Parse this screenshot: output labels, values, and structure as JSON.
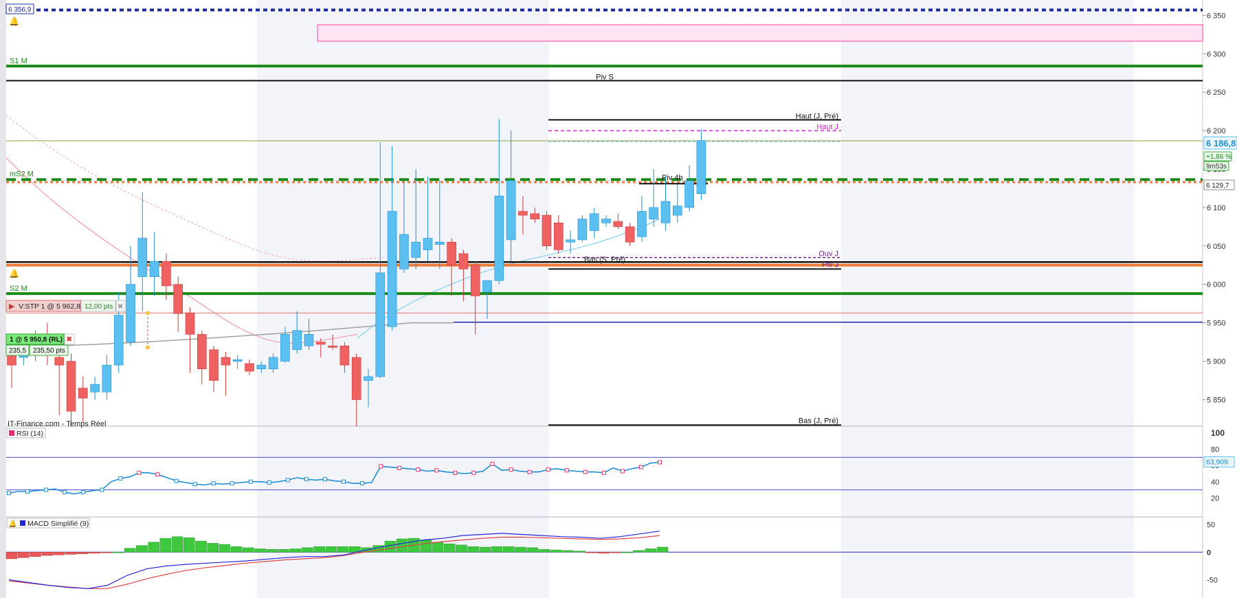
{
  "colors": {
    "up": "#5bc0f0",
    "up_stroke": "#1f8fd0",
    "down": "#f06262",
    "down_stroke": "#c83a3a",
    "green": "#188a18",
    "orange": "#f07c3a",
    "navy": "#1c2a9c",
    "magenta": "#d41ed4",
    "rsi": "#e83070",
    "macd": "#2626d6",
    "signal": "#e04040",
    "hist": "#3ec83e"
  },
  "source_label": "IT-Finance.com - Temps Réel",
  "price_box": {
    "value": "6 186,8",
    "change": "+1,86 %",
    "timer": "9m53s"
  },
  "marker_129": "6 129,7",
  "alert_top": "6 356,9",
  "order_stop": {
    "label": "V:STP  1 @ 5 962,8",
    "pts": "12,00 pts",
    "x": "✖"
  },
  "order_pos": {
    "label": "1 @ 5 950,8 (RL)",
    "val": "235,5",
    "pts": "235,50 pts",
    "x": "✖"
  },
  "chart_data": [
    {
      "type": "candlestick",
      "ylim": [
        5820,
        6370
      ],
      "y_ticks": [
        5850,
        5900,
        5950,
        6000,
        6050,
        6100,
        6150,
        6200,
        6250,
        6300,
        6350
      ],
      "y_tick_labels": [
        "5 850",
        "5 900",
        "5 950",
        "6 000",
        "6 050",
        "6 100",
        "6 150",
        "6 200",
        "6 250",
        "6 300",
        "6 350"
      ],
      "candles": [
        {
          "o": 5910,
          "h": 5930,
          "l": 5865,
          "c": 5895
        },
        {
          "o": 5905,
          "h": 5935,
          "l": 5895,
          "c": 5915
        },
        {
          "o": 5915,
          "h": 5940,
          "l": 5900,
          "c": 5920
        },
        {
          "o": 5918,
          "h": 5950,
          "l": 5895,
          "c": 5910
        },
        {
          "o": 5905,
          "h": 5935,
          "l": 5830,
          "c": 5895
        },
        {
          "o": 5900,
          "h": 5910,
          "l": 5815,
          "c": 5835
        },
        {
          "o": 5865,
          "h": 5880,
          "l": 5820,
          "c": 5852
        },
        {
          "o": 5860,
          "h": 5880,
          "l": 5850,
          "c": 5870
        },
        {
          "o": 5860,
          "h": 5908,
          "l": 5850,
          "c": 5895
        },
        {
          "o": 5895,
          "h": 5990,
          "l": 5885,
          "c": 5960
        },
        {
          "o": 5925,
          "h": 6050,
          "l": 5920,
          "c": 6000
        },
        {
          "o": 6010,
          "h": 6120,
          "l": 5965,
          "c": 6060
        },
        {
          "o": 6010,
          "h": 6068,
          "l": 5985,
          "c": 6030
        },
        {
          "o": 6030,
          "h": 6040,
          "l": 5980,
          "c": 5998
        },
        {
          "o": 6000,
          "h": 6010,
          "l": 5938,
          "c": 5962
        },
        {
          "o": 5963,
          "h": 5970,
          "l": 5885,
          "c": 5935
        },
        {
          "o": 5935,
          "h": 5940,
          "l": 5870,
          "c": 5890
        },
        {
          "o": 5915,
          "h": 5920,
          "l": 5860,
          "c": 5875
        },
        {
          "o": 5905,
          "h": 5912,
          "l": 5855,
          "c": 5895
        },
        {
          "o": 5900,
          "h": 5908,
          "l": 5890,
          "c": 5902
        },
        {
          "o": 5897,
          "h": 5902,
          "l": 5882,
          "c": 5887
        },
        {
          "o": 5890,
          "h": 5900,
          "l": 5885,
          "c": 5895
        },
        {
          "o": 5890,
          "h": 5910,
          "l": 5885,
          "c": 5905
        },
        {
          "o": 5900,
          "h": 5945,
          "l": 5898,
          "c": 5935
        },
        {
          "o": 5915,
          "h": 5965,
          "l": 5910,
          "c": 5940
        },
        {
          "o": 5920,
          "h": 5955,
          "l": 5915,
          "c": 5935
        },
        {
          "o": 5925,
          "h": 5930,
          "l": 5905,
          "c": 5922
        },
        {
          "o": 5920,
          "h": 5935,
          "l": 5915,
          "c": 5918
        },
        {
          "o": 5920,
          "h": 5925,
          "l": 5885,
          "c": 5895
        },
        {
          "o": 5905,
          "h": 5910,
          "l": 5815,
          "c": 5850
        },
        {
          "o": 5875,
          "h": 5890,
          "l": 5840,
          "c": 5880
        },
        {
          "o": 5880,
          "h": 6185,
          "l": 5878,
          "c": 6015
        },
        {
          "o": 5945,
          "h": 6180,
          "l": 5940,
          "c": 6095
        },
        {
          "o": 6020,
          "h": 6135,
          "l": 6015,
          "c": 6065
        },
        {
          "o": 6035,
          "h": 6150,
          "l": 6020,
          "c": 6055
        },
        {
          "o": 6045,
          "h": 6140,
          "l": 6030,
          "c": 6060
        },
        {
          "o": 6052,
          "h": 6135,
          "l": 6020,
          "c": 6055
        },
        {
          "o": 6055,
          "h": 6060,
          "l": 5985,
          "c": 6025
        },
        {
          "o": 6040,
          "h": 6045,
          "l": 5978,
          "c": 6020
        },
        {
          "o": 6025,
          "h": 6030,
          "l": 5935,
          "c": 5985
        },
        {
          "o": 5990,
          "h": 6000,
          "l": 5955,
          "c": 6005
        },
        {
          "o": 6005,
          "h": 6215,
          "l": 6000,
          "c": 6115
        },
        {
          "o": 6058,
          "h": 6200,
          "l": 6030,
          "c": 6135
        },
        {
          "o": 6095,
          "h": 6115,
          "l": 6065,
          "c": 6090
        },
        {
          "o": 6092,
          "h": 6100,
          "l": 6080,
          "c": 6085
        },
        {
          "o": 6090,
          "h": 6095,
          "l": 6045,
          "c": 6050
        },
        {
          "o": 6080,
          "h": 6090,
          "l": 6040,
          "c": 6045
        },
        {
          "o": 6055,
          "h": 6070,
          "l": 6040,
          "c": 6058
        },
        {
          "o": 6058,
          "h": 6090,
          "l": 6055,
          "c": 6085
        },
        {
          "o": 6070,
          "h": 6100,
          "l": 6060,
          "c": 6092
        },
        {
          "o": 6080,
          "h": 6090,
          "l": 6075,
          "c": 6085
        },
        {
          "o": 6082,
          "h": 6092,
          "l": 6072,
          "c": 6075
        },
        {
          "o": 6075,
          "h": 6080,
          "l": 6050,
          "c": 6055
        },
        {
          "o": 6062,
          "h": 6115,
          "l": 6055,
          "c": 6095
        },
        {
          "o": 6085,
          "h": 6150,
          "l": 6075,
          "c": 6100
        },
        {
          "o": 6080,
          "h": 6140,
          "l": 6070,
          "c": 6108
        },
        {
          "o": 6090,
          "h": 6130,
          "l": 6080,
          "c": 6102
        },
        {
          "o": 6100,
          "h": 6155,
          "l": 6095,
          "c": 6135
        },
        {
          "o": 6118,
          "h": 6202,
          "l": 6110,
          "c": 6187
        }
      ],
      "levels": [
        {
          "y": 6357,
          "label": ""
        },
        {
          "y": 6284,
          "label": "S1 M"
        },
        {
          "y": 6265,
          "label": "Piv S"
        },
        {
          "y": 6214,
          "label": "Haut (J, Pré)"
        },
        {
          "y": 6200,
          "label": "Haut J"
        },
        {
          "y": 6186.8,
          "label": ""
        },
        {
          "y": 6137,
          "label": "mS2 M"
        },
        {
          "y": 6133,
          "label": "Piv 4h"
        },
        {
          "y": 6035,
          "label": "Ouv J"
        },
        {
          "y": 6032,
          "label": "Bas (S, Pré)"
        },
        {
          "y": 6029,
          "label": "Piv J"
        },
        {
          "y": 6026,
          "label": ""
        },
        {
          "y": 6020,
          "label": ""
        },
        {
          "y": 5988,
          "label": "S2 M"
        },
        {
          "y": 5962.8,
          "label": ""
        },
        {
          "y": 5950.8,
          "label": ""
        },
        {
          "y": 5817,
          "label": "Bas (J, Pré)"
        }
      ]
    },
    {
      "type": "line",
      "title": "RSI (14)",
      "ylim": [
        0,
        100
      ],
      "y_ticks": [
        20,
        40,
        60,
        80,
        100
      ],
      "last_value": "63,909",
      "values": [
        26,
        28,
        28,
        29,
        30,
        31,
        27,
        25,
        27,
        29,
        30,
        40,
        44,
        46,
        51,
        51,
        49,
        45,
        41,
        39,
        37,
        36,
        38,
        37,
        38,
        39,
        40,
        40,
        39,
        40,
        42,
        45,
        43,
        42,
        43,
        41,
        40,
        38,
        38,
        39,
        59,
        58,
        57,
        56,
        55,
        53,
        54,
        52,
        51,
        50,
        51,
        53,
        62,
        54,
        55,
        53,
        52,
        52,
        55,
        56,
        54,
        53,
        52,
        52,
        51,
        57,
        53,
        56,
        58,
        63,
        64
      ],
      "upper": 70,
      "lower": 30
    },
    {
      "type": "bar_line",
      "title": "MACD Simplifié (9)",
      "ylim": [
        -78,
        60
      ],
      "y_ticks": [
        50,
        0,
        -50
      ],
      "y_tick_labels": [
        "50",
        "0",
        "-50"
      ],
      "histogram": [
        -12,
        -10,
        -8,
        -6,
        -5,
        -4,
        -3,
        -2,
        -1,
        0,
        7,
        12,
        18,
        25,
        28,
        26,
        20,
        16,
        14,
        10,
        8,
        6,
        5,
        5,
        6,
        8,
        10,
        10,
        10,
        10,
        8,
        12,
        20,
        24,
        25,
        22,
        18,
        15,
        13,
        10,
        9,
        10,
        10,
        9,
        8,
        5,
        4,
        3,
        2,
        -1,
        -2,
        -1,
        0,
        3,
        6,
        9
      ],
      "macd": [
        -50,
        -55,
        -60,
        -64,
        -66,
        -60,
        -42,
        -30,
        -25,
        -22,
        -20,
        -18,
        -16,
        -13,
        -10,
        -8,
        -8,
        -5,
        3,
        10,
        16,
        22,
        25,
        30,
        32,
        34,
        32,
        30,
        28,
        27,
        25,
        28,
        33,
        38
      ],
      "signal": [
        -52,
        -56,
        -60,
        -63,
        -66,
        -66,
        -58,
        -48,
        -40,
        -33,
        -28,
        -24,
        -20,
        -17,
        -14,
        -12,
        -10,
        -6,
        0,
        5,
        10,
        15,
        19,
        22,
        25,
        27,
        27,
        26,
        25,
        24,
        23,
        24,
        26,
        30
      ]
    }
  ]
}
